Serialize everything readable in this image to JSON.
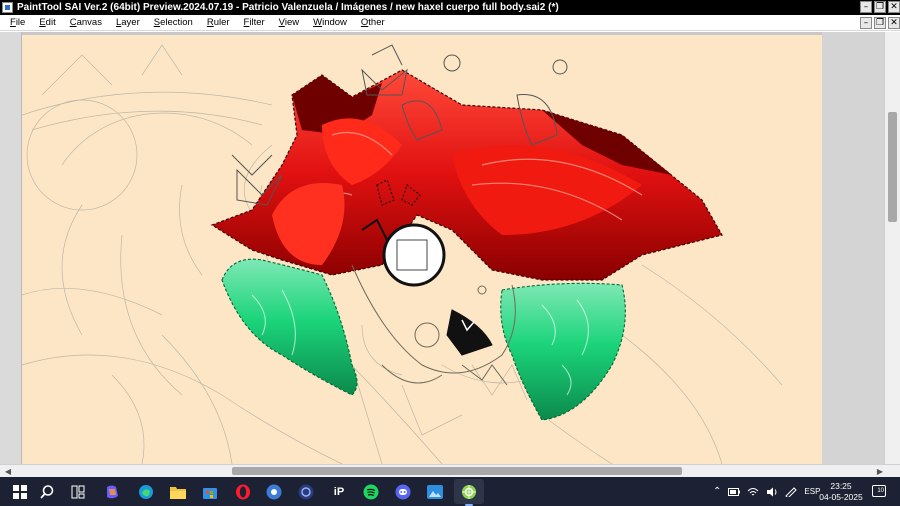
{
  "window": {
    "title": "PaintTool SAI Ver.2 (64bit) Preview.2024.07.19 - Patricio Valenzuela / Imágenes / new haxel cuerpo full body.sai2 (*)",
    "controls": {
      "minimize": "–",
      "restore": "❐",
      "close": "✕"
    }
  },
  "menubar": {
    "items": [
      {
        "label": "File",
        "mnemonic": "F"
      },
      {
        "label": "Edit",
        "mnemonic": "E"
      },
      {
        "label": "Canvas",
        "mnemonic": "C"
      },
      {
        "label": "Layer",
        "mnemonic": "L"
      },
      {
        "label": "Selection",
        "mnemonic": "S"
      },
      {
        "label": "Ruler",
        "mnemonic": "R"
      },
      {
        "label": "Filter",
        "mnemonic": "F"
      },
      {
        "label": "View",
        "mnemonic": "V"
      },
      {
        "label": "Window",
        "mnemonic": "W"
      },
      {
        "label": "Other",
        "mnemonic": "O"
      }
    ]
  },
  "canvas": {
    "background_color": "#fde6c6",
    "artwork": [
      "sketch-lines",
      "red-hair",
      "green-hair",
      "character-face",
      "selection-marquee"
    ],
    "colors": {
      "hair_red": "#e01010",
      "hair_dark_red": "#6e0000",
      "hair_green": "#1bd47a",
      "hair_dark_green": "#0b8a4c"
    }
  },
  "taskbar": {
    "apps": [
      {
        "name": "windows-start-icon"
      },
      {
        "name": "search-icon"
      },
      {
        "name": "task-view-icon"
      },
      {
        "name": "copilot-icon"
      },
      {
        "name": "edge-icon"
      },
      {
        "name": "file-explorer-icon"
      },
      {
        "name": "microsoft-store-icon"
      },
      {
        "name": "opera-icon"
      },
      {
        "name": "blue-app-icon"
      },
      {
        "name": "dark-circle-app-icon"
      },
      {
        "name": "ip-app-icon",
        "text": "iP"
      },
      {
        "name": "spotify-icon"
      },
      {
        "name": "discord-icon"
      },
      {
        "name": "photos-icon"
      },
      {
        "name": "painttool-sai-icon"
      }
    ],
    "tray": {
      "language": "ESP",
      "time": "23:25",
      "date": "04-05-2025",
      "notifications": "10"
    }
  }
}
